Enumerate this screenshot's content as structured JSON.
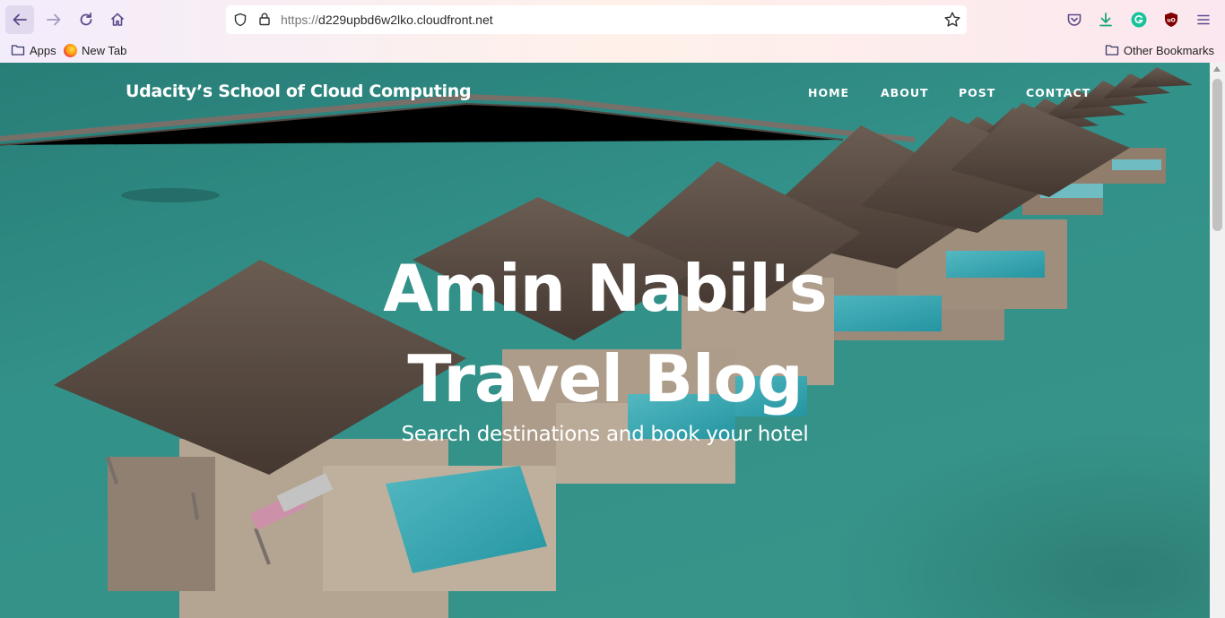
{
  "browser": {
    "url_protocol": "https://",
    "url_host": "d229upbd6w2lko.cloudfront.net",
    "bookmarks": [
      {
        "label": "Apps",
        "icon": "folder-icon"
      },
      {
        "label": "New Tab",
        "icon": "firefox-icon"
      }
    ],
    "other_bookmarks": "Other Bookmarks",
    "icons": {
      "back": "back-arrow-icon",
      "forward": "forward-arrow-icon",
      "reload": "reload-icon",
      "home": "home-icon",
      "shield": "shield-icon",
      "lock": "lock-icon",
      "star": "star-icon",
      "pocket": "pocket-icon",
      "download": "download-icon",
      "grammarly": "grammarly-icon",
      "ublock": "ublock-icon",
      "menu": "hamburger-menu-icon"
    },
    "colors": {
      "accent": "#7b4fc4",
      "download": "#1ba67a",
      "grammarly": "#15c39a",
      "ublock": "#800000"
    }
  },
  "site": {
    "brand": "Udacity’s School of Cloud Computing",
    "nav": [
      "HOME",
      "ABOUT",
      "POST",
      "CONTACT"
    ],
    "headline_line1": "Amin Nabil's",
    "headline_line2": "Travel Blog",
    "subheading": "Search destinations and book your hotel",
    "background": "maldives-overwater-villas-image"
  }
}
